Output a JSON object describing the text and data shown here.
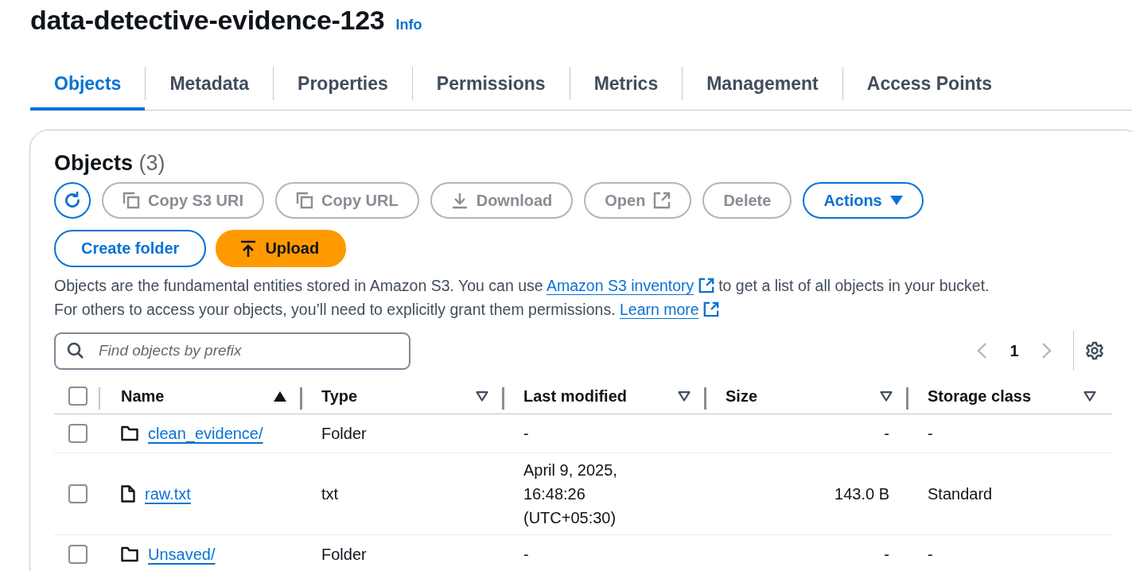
{
  "bucket": {
    "title": "data-detective-evidence-123",
    "info_link": "Info"
  },
  "tabs": [
    {
      "label": "Objects",
      "selected": true
    },
    {
      "label": "Metadata",
      "selected": false
    },
    {
      "label": "Properties",
      "selected": false
    },
    {
      "label": "Permissions",
      "selected": false
    },
    {
      "label": "Metrics",
      "selected": false
    },
    {
      "label": "Management",
      "selected": false
    },
    {
      "label": "Access Points",
      "selected": false
    }
  ],
  "objects_panel": {
    "heading": "Objects",
    "count": "(3)",
    "toolbar": [
      {
        "kind": "refresh",
        "disabled": false
      },
      {
        "kind": "copy",
        "label": "Copy S3 URI",
        "disabled": true
      },
      {
        "kind": "copy",
        "label": "Copy URL",
        "disabled": true
      },
      {
        "kind": "download",
        "label": "Download",
        "disabled": true
      },
      {
        "kind": "external",
        "label": "Open",
        "disabled": true
      },
      {
        "kind": "plain",
        "label": "Delete",
        "disabled": true
      },
      {
        "kind": "dropdown",
        "label": "Actions",
        "disabled": false
      }
    ],
    "actions": [
      {
        "kind": "outline",
        "label": "Create folder"
      },
      {
        "kind": "upload",
        "label": "Upload"
      }
    ],
    "description": [
      [
        {
          "kind": "text",
          "text": "Objects are the fundamental entities stored in Amazon S3. You can use "
        },
        {
          "kind": "link",
          "text": "Amazon S3 inventory"
        },
        {
          "kind": "text",
          "text": " to get a list of all objects in your bucket."
        }
      ],
      [
        {
          "kind": "text",
          "text": "For others to access your objects, you’ll need to explicitly grant them permissions. "
        },
        {
          "kind": "link",
          "text": "Learn more"
        }
      ]
    ],
    "search": {
      "placeholder": "Find objects by prefix"
    },
    "pagination": {
      "page": "1"
    },
    "table": {
      "select_all_checked": false,
      "columns": [
        {
          "label": "Name",
          "sorted": true
        },
        {
          "label": "Type",
          "sorted": false
        },
        {
          "label": "Last modified",
          "sorted": false
        },
        {
          "label": "Size",
          "sorted": false
        },
        {
          "label": "Storage class",
          "sorted": false
        }
      ],
      "rows": [
        {
          "selected": false,
          "kind": "folder",
          "name": "clean_evidence/",
          "type": "Folder",
          "last_modified": [
            "-"
          ],
          "size": "-",
          "storage_class": "-"
        },
        {
          "selected": false,
          "kind": "file",
          "name": "raw.txt",
          "type": "txt",
          "last_modified": [
            "April 9, 2025,",
            "16:48:26",
            "(UTC+05:30)"
          ],
          "size": "143.0 B",
          "storage_class": "Standard"
        },
        {
          "selected": false,
          "kind": "folder",
          "name": "Unsaved/",
          "type": "Folder",
          "last_modified": [
            "-"
          ],
          "size": "-",
          "storage_class": "-"
        }
      ]
    }
  }
}
